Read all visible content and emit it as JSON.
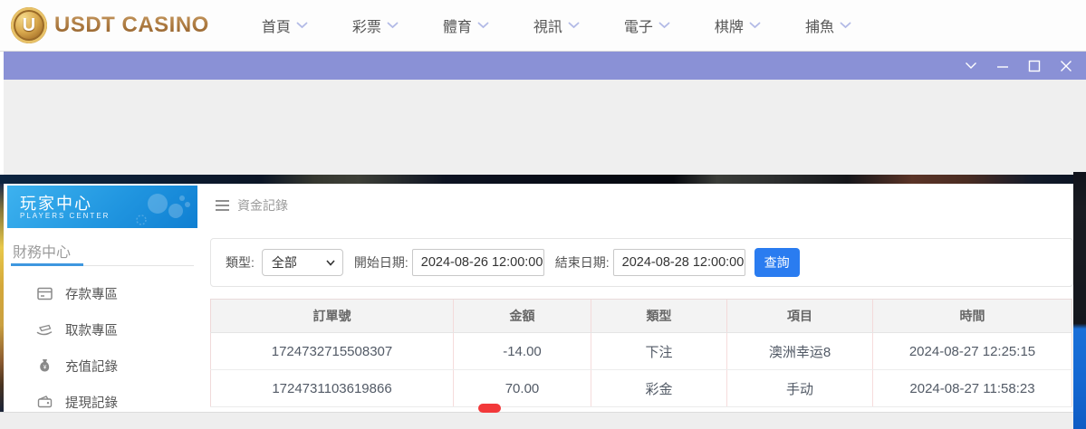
{
  "topnav": {
    "logo_badge": "U",
    "logo_text": "USDT CASINO",
    "items": [
      {
        "label": "首頁"
      },
      {
        "label": "彩票"
      },
      {
        "label": "體育"
      },
      {
        "label": "視訊"
      },
      {
        "label": "電子"
      },
      {
        "label": "棋牌"
      },
      {
        "label": "捕魚"
      }
    ]
  },
  "window": {
    "controls": [
      "chevron-down",
      "minimize",
      "maximize",
      "close"
    ]
  },
  "sidebar": {
    "title": "玩家中心",
    "subtitle": "PLAYERS CENTER",
    "section": "財務中心",
    "items": [
      {
        "label": "存款專區",
        "icon": "deposit-card-icon"
      },
      {
        "label": "取款專區",
        "icon": "withdraw-hand-icon"
      },
      {
        "label": "充值記錄",
        "icon": "moneybag-icon"
      },
      {
        "label": "提現記錄",
        "icon": "wallet-icon"
      }
    ]
  },
  "main": {
    "breadcrumb": "資金記錄",
    "filters": {
      "type_label": "類型:",
      "type_value": "全部",
      "start_label": "開始日期:",
      "start_value": "2024-08-26 12:00:00",
      "end_label": "結束日期:",
      "end_value": "2024-08-28 12:00:00",
      "search_label": "查詢"
    },
    "table": {
      "headers": [
        "訂單號",
        "金額",
        "類型",
        "項目",
        "時間"
      ],
      "rows": [
        {
          "order": "1724732715508307",
          "amount": "-14.00",
          "type": "下注",
          "item": "澳洲幸运8",
          "time": "2024-08-27 12:25:15"
        },
        {
          "order": "1724731103619866",
          "amount": "70.00",
          "type": "彩金",
          "item": "手动",
          "time": "2024-08-27 11:58:23"
        }
      ]
    }
  },
  "colors": {
    "titlebar": "#8a91d6",
    "accent_blue": "#2a7cf0",
    "banner_blue_top": "#3db2ef",
    "banner_blue_bottom": "#0f7fd2",
    "logo_gold": "#a9763c",
    "table_divider_pink": "#f6dcdc",
    "right_edge_blue": "#1668d2",
    "indicator_red": "#f2383a"
  }
}
